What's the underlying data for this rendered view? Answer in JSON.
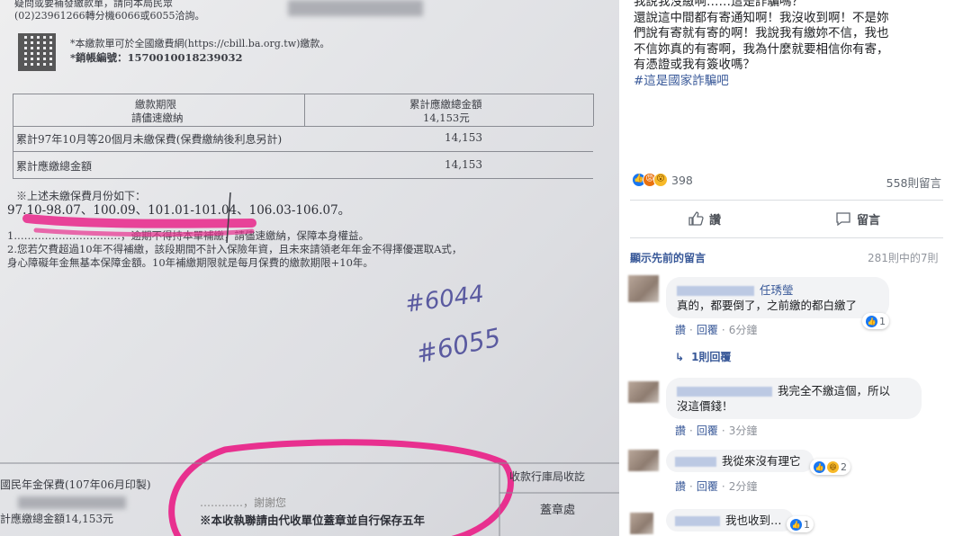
{
  "document": {
    "header_line1": "疑問或要補發繳款單，請向本局民眾",
    "header_line2": "(02)23961266轉分機6066或6055洽詢。",
    "cbill_note": "*本繳款單可於全國繳費網(https://cbill.ba.org.tw)繳款。",
    "cbill_code": "*銷帳編號：15700100182​39032",
    "col_left_l1": "繳款期限",
    "col_left_l2": "請儘速繳納",
    "col_right_l1": "累計應繳總金額",
    "col_right_l2": "14,153元",
    "row1_label": "累計97年10月等20個月未繳保費(保費繳納後利息另計)",
    "row1_value": "14,153",
    "row2_label": "累計應繳總金額",
    "row2_value": "14,153",
    "months_title": "※上述未繳保費月份如下：",
    "months_list": "97.10-98.07、100.09、101.01-101.04、106.03-106.07。",
    "notice_line1": "1.…………………………，逾期不得持本單補繳，請儘速繳納，保障本身權益。",
    "notice_line2": "2.您若欠費超過10年不得補繳，該段期間不計入保險年資，且未來請領老年年金不得擇優選取A式，",
    "notice_line3": "身心障礙年金無基本保障金額。10年補繳期限就是每月保費的繳款期限+10年。",
    "handwriting1": "#6044",
    "handwriting2": "#6055",
    "footer_left1": "國民年金保費(107年06月印製)",
    "footer_left2": "計應繳總金額14,153元",
    "footer_mid_title": "…………，謝謝您",
    "footer_mid_note": "※本收執聯請由代收單位蓋章並自行保存五年",
    "footer_right1": "收款行庫局收訖",
    "footer_right2": "蓋章處"
  },
  "post": {
    "line0": "我說我沒繳啊……這是詐騙嗎？",
    "line1": "還說這中間都有寄通知啊！我沒收到啊！不是妳",
    "line2": "們說有寄就有寄的啊！我說我有繳妳不信，我也",
    "line3": "不信妳真的有寄啊，我為什麼就要相信你有寄，",
    "line4": "有憑證或我有簽收嗎？",
    "hashtag": "#這是國家詐騙吧",
    "reaction_count": "398",
    "comment_count": "558則留言",
    "like_label": "讚",
    "comment_label": "留言"
  },
  "comments": {
    "show_previous": "顯示先前的留言",
    "count_of": "281則中的7則",
    "like": "讚",
    "reply": "回覆",
    "items": [
      {
        "name": "任琇瑩",
        "text": "真的，都要倒了，之前繳的都白繳了",
        "time": "6分鐘",
        "react": "1"
      },
      {
        "text": "我完全不繳這個，所以",
        "text2": "沒這價錢！",
        "time": "3分鐘"
      },
      {
        "text": "我從來沒有理它",
        "time": "2分鐘",
        "react": "2"
      },
      {
        "text": "我也收到…",
        "react": "1"
      }
    ],
    "replies_link": "1則回覆"
  },
  "colors": {
    "marker_pink": "#e8308f",
    "fb_blue": "#385898",
    "like_blue": "#1877f2"
  }
}
